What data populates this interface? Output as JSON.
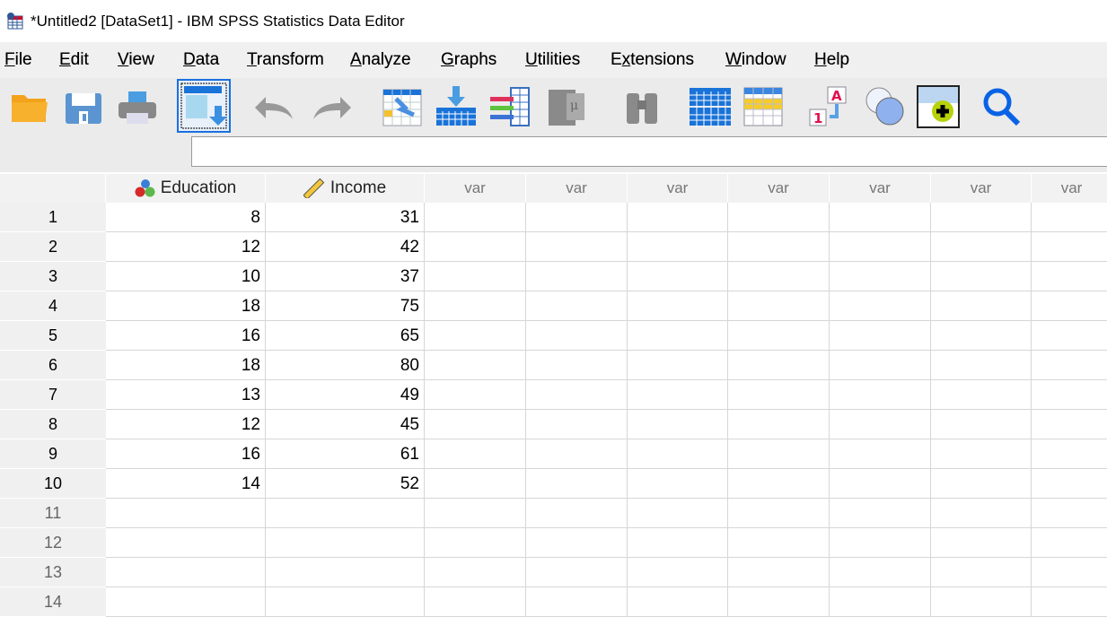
{
  "window": {
    "title": "*Untitled2 [DataSet1] - IBM SPSS Statistics Data Editor"
  },
  "menu": [
    {
      "label": "File",
      "ul": "F",
      "rest": "ile"
    },
    {
      "label": "Edit",
      "ul": "E",
      "rest": "dit"
    },
    {
      "label": "View",
      "ul": "V",
      "rest": "iew"
    },
    {
      "label": "Data",
      "ul": "D",
      "rest": "ata"
    },
    {
      "label": "Transform",
      "ul": "T",
      "rest": "ransform"
    },
    {
      "label": "Analyze",
      "ul": "A",
      "rest": "nalyze"
    },
    {
      "label": "Graphs",
      "ul": "G",
      "rest": "raphs"
    },
    {
      "label": "Utilities",
      "ul": "U",
      "rest": "tilities"
    },
    {
      "label": "Extensions",
      "pre": "E",
      "ul": "x",
      "rest": "tensions"
    },
    {
      "label": "Window",
      "ul": "W",
      "rest": "indow"
    },
    {
      "label": "Help",
      "ul": "H",
      "rest": "elp"
    }
  ],
  "toolbar": [
    "open-folder-icon",
    "save-icon",
    "print-icon",
    "recall-dialog-icon",
    "undo-icon",
    "redo-icon",
    "go-to-case-icon",
    "go-to-variable-icon",
    "variables-icon",
    "run-descriptives-icon",
    "find-icon",
    "split-file-icon",
    "select-cases-icon",
    "value-labels-icon",
    "use-variable-sets-icon",
    "spelling-icon",
    "search-icon"
  ],
  "cell_editor": {
    "value": ""
  },
  "columns": [
    {
      "name": "Education",
      "icon": "nominal-measure-icon"
    },
    {
      "name": "Income",
      "icon": "scale-measure-icon"
    },
    {
      "name": "var"
    },
    {
      "name": "var"
    },
    {
      "name": "var"
    },
    {
      "name": "var"
    },
    {
      "name": "var"
    },
    {
      "name": "var"
    },
    {
      "name": "var"
    }
  ],
  "rows": [
    {
      "n": "1",
      "v": [
        "8",
        "31"
      ]
    },
    {
      "n": "2",
      "v": [
        "12",
        "42"
      ]
    },
    {
      "n": "3",
      "v": [
        "10",
        "37"
      ]
    },
    {
      "n": "4",
      "v": [
        "18",
        "75"
      ]
    },
    {
      "n": "5",
      "v": [
        "16",
        "65"
      ]
    },
    {
      "n": "6",
      "v": [
        "18",
        "80"
      ]
    },
    {
      "n": "7",
      "v": [
        "13",
        "49"
      ]
    },
    {
      "n": "8",
      "v": [
        "12",
        "45"
      ]
    },
    {
      "n": "9",
      "v": [
        "16",
        "61"
      ]
    },
    {
      "n": "10",
      "v": [
        "14",
        "52"
      ]
    },
    {
      "n": "11",
      "v": [
        "",
        ""
      ]
    },
    {
      "n": "12",
      "v": [
        "",
        ""
      ]
    },
    {
      "n": "13",
      "v": [
        "",
        ""
      ]
    },
    {
      "n": "14",
      "v": [
        "",
        ""
      ]
    }
  ]
}
